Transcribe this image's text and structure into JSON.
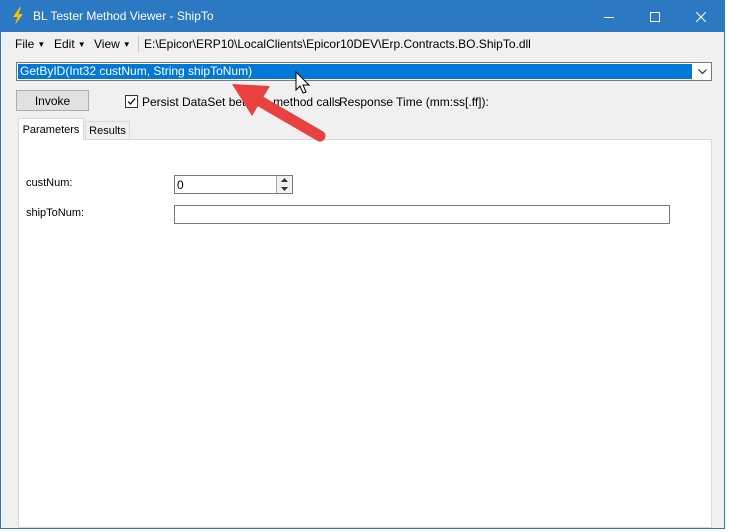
{
  "window": {
    "title": "BL Tester Method Viewer - ShipTo"
  },
  "menu": {
    "file": "File",
    "edit": "Edit",
    "view": "View",
    "path": "E:\\Epicor\\ERP10\\LocalClients\\Epicor10DEV\\Erp.Contracts.BO.ShipTo.dll"
  },
  "method_select": {
    "selected": "GetByID(Int32 custNum, String shipToNum)"
  },
  "toolbar": {
    "invoke_label": "Invoke",
    "persist_label": "Persist DataSet betw",
    "persist_suffix": "method calls",
    "persist_checked": true,
    "response_time_label": "Response Time (mm:ss[.ff]):"
  },
  "tabs": [
    {
      "label": "Parameters",
      "active": true
    },
    {
      "label": "Results",
      "active": false
    }
  ],
  "parameters": [
    {
      "label": "custNum:",
      "value": "0"
    },
    {
      "label": "shipToNum:",
      "value": ""
    }
  ],
  "colors": {
    "titlebar": "#2b79c2",
    "selection": "#0078d7",
    "annotation_arrow": "#e8413f"
  },
  "icons": [
    "lightning-icon",
    "minimize-icon",
    "maximize-icon",
    "close-icon",
    "chevron-down-icon",
    "spin-up-icon",
    "spin-down-icon",
    "checkmark-icon",
    "mouse-cursor-icon",
    "annotation-arrow-icon"
  ]
}
